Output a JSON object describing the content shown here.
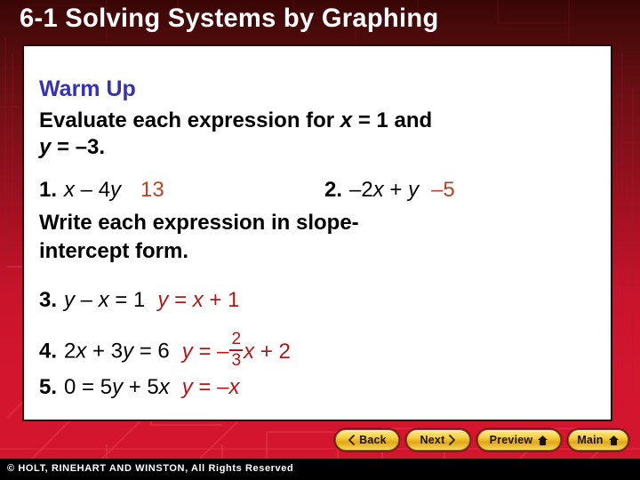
{
  "slide": {
    "title": "6-1  Solving Systems by Graphing",
    "title_color": "#ffffff",
    "background_color": "#d4152e",
    "panel_background": "#ffffff"
  },
  "content": {
    "heading": "Warm Up",
    "heading_color": "#3531B8",
    "instruction_line_1": "Evaluate each expression for ",
    "instruction_line_1_var": "x",
    "instruction_line_1_tail": " = 1 and",
    "instruction_line_2_var": "y",
    "instruction_line_2_tail": " = –3.",
    "instruction_line_3": "Write each expression in slope-",
    "instruction_line_4": "intercept form.",
    "answer_color_orange": "#BE4122",
    "answer_color_red": "#B01818"
  },
  "problems": [
    {
      "number": "1.",
      "expression_parts": [
        "x",
        " – 4",
        "y"
      ],
      "answer": "13",
      "answer_color": "#BE4122"
    },
    {
      "number": "2.",
      "expression_parts": [
        "–2",
        "x",
        " + ",
        "y"
      ],
      "answer": "–5",
      "answer_color": "#BE4122"
    },
    {
      "number": "3.",
      "expression_parts": [
        "y",
        " – ",
        "x",
        " = 1"
      ],
      "answer": "y = x + 1",
      "answer_color": "#B01818"
    },
    {
      "number": "4.",
      "expression_parts": [
        "2",
        "x",
        " + 3",
        "y",
        " = 6"
      ],
      "answer": "y = –(2/3)x + 2",
      "answer_numerator": "2",
      "answer_denominator": "3",
      "answer_color": "#B01818"
    },
    {
      "number": "5.",
      "expression_parts": [
        "0 = 5",
        "y",
        " + 5",
        "x"
      ],
      "answer": "y = –x",
      "answer_color": "#B01818"
    }
  ],
  "problem_glyphs": {
    "p1_num": "1.",
    "p1_x": "x",
    "p1_mid": " – 4",
    "p1_y": "y",
    "p1_answer": "13",
    "p2_num": "2.",
    "p2_lead": "–2",
    "p2_x": "x",
    "p2_mid": " + ",
    "p2_y": "y",
    "p2_answer": "–5",
    "p3_num": "3.",
    "p3_y": "y",
    "p3_mid": " – ",
    "p3_x": "x",
    "p3_tail": " = 1",
    "p3_ans_y": "y",
    "p3_ans_eq": " = ",
    "p3_ans_x": "x",
    "p3_ans_tail": " + 1",
    "p4_num": "4.",
    "p4_lead": "2",
    "p4_x": "x",
    "p4_mid": " + 3",
    "p4_y": "y",
    "p4_tail": " = 6",
    "p4_ans_y": "y",
    "p4_ans_eq": " = –",
    "p4_ans_numer": "2",
    "p4_ans_denom": "3",
    "p4_ans_x": "x",
    "p4_ans_tail": " + 2",
    "p5_num": "5.",
    "p5_lead": "0 = 5",
    "p5_y": "y",
    "p5_mid": " + 5",
    "p5_x": "x",
    "p5_ans_y": "y",
    "p5_ans_eq": " = –",
    "p5_ans_x": "x"
  },
  "navigation": {
    "buttons": [
      {
        "label": "Back",
        "icon": "chevron-left-icon"
      },
      {
        "label": "Next",
        "icon": "chevron-right-icon"
      },
      {
        "label": "Preview",
        "icon": "home-icon"
      },
      {
        "label": "Main",
        "icon": "home-icon"
      }
    ],
    "button_color": "#F6CF3F"
  },
  "footer": {
    "text": "© HOLT, RINEHART AND WINSTON, All Rights Reserved",
    "background": "#000000",
    "color": "#ffffff"
  }
}
